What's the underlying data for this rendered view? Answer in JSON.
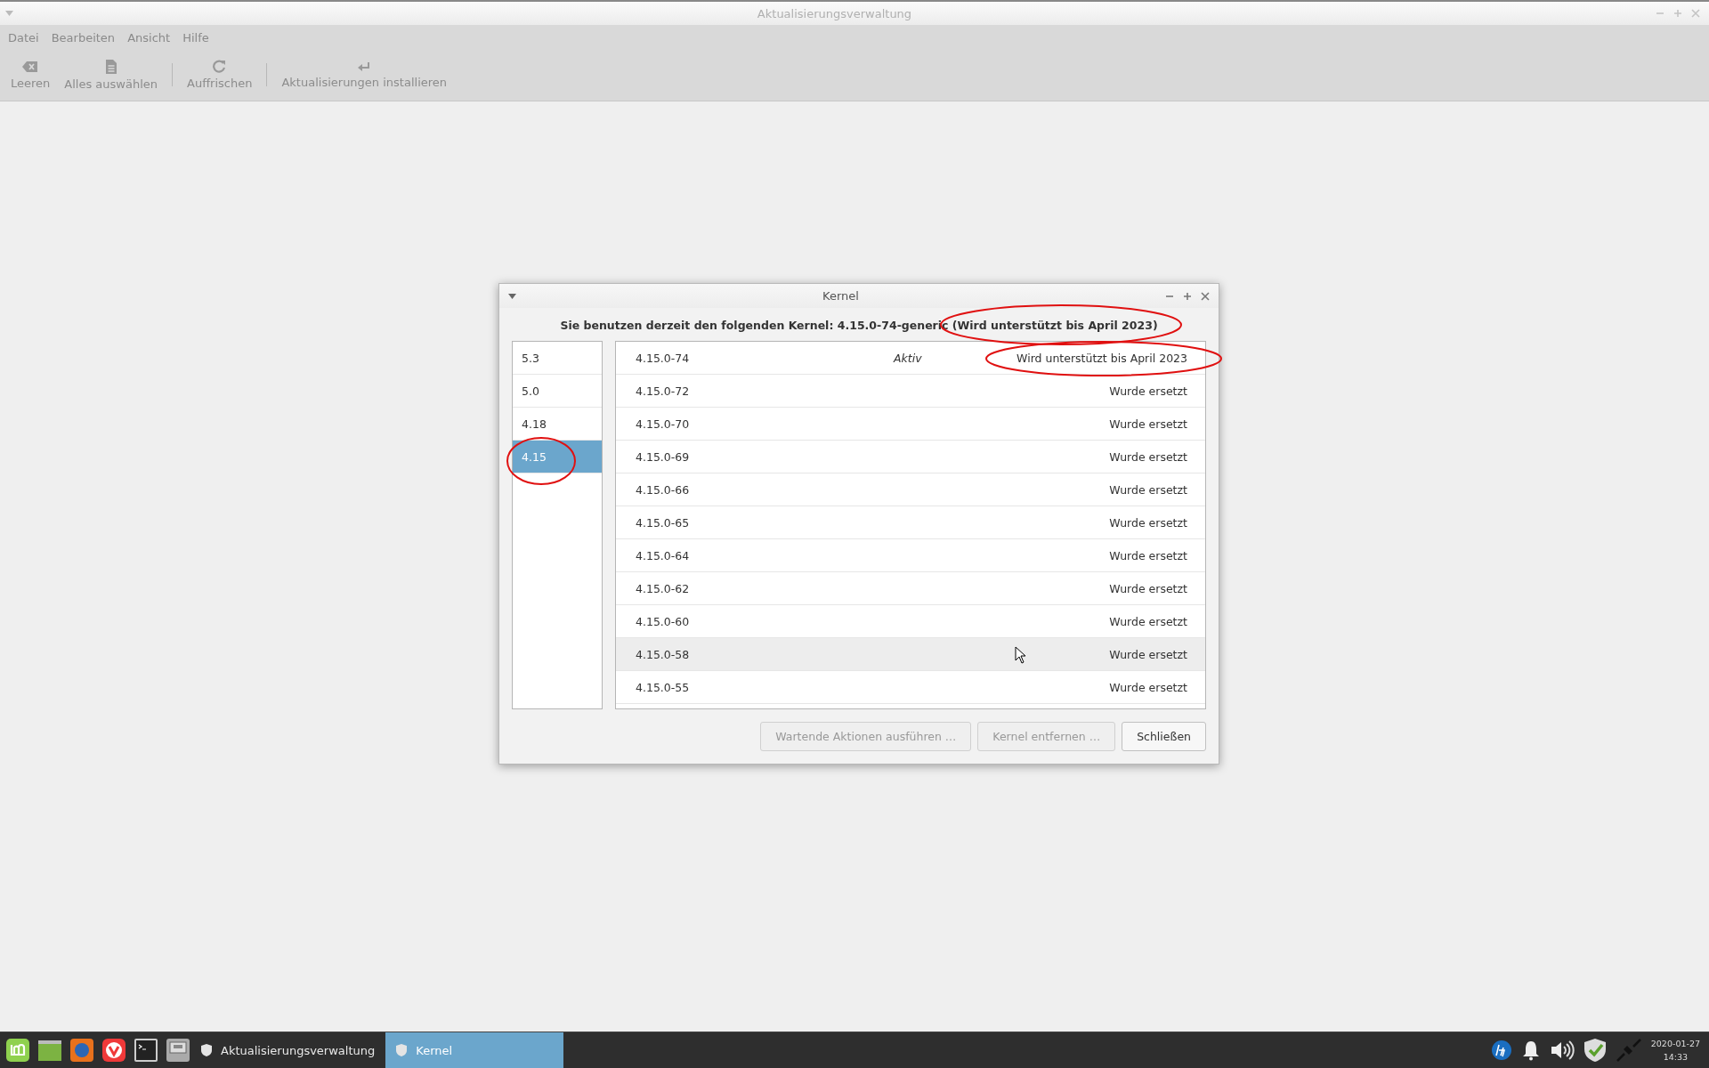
{
  "window": {
    "title": "Aktualisierungsverwaltung"
  },
  "menu": [
    "Datei",
    "Bearbeiten",
    "Ansicht",
    "Hilfe"
  ],
  "toolbar": [
    {
      "kind": "clear",
      "label": "Leeren"
    },
    {
      "kind": "selectall",
      "label": "Alles auswählen"
    },
    {
      "kind": "separator"
    },
    {
      "kind": "refresh",
      "label": "Auffrischen"
    },
    {
      "kind": "separator"
    },
    {
      "kind": "install",
      "label": "Aktualisierungen installieren"
    }
  ],
  "dialog": {
    "title": "Kernel",
    "headline": "Sie benutzen derzeit den folgenden Kernel: 4.15.0-74-generic (Wird unterstützt bis April 2023)",
    "series": [
      {
        "label": "5.3",
        "selected": false
      },
      {
        "label": "5.0",
        "selected": false
      },
      {
        "label": "4.18",
        "selected": false
      },
      {
        "label": "4.15",
        "selected": true
      }
    ],
    "kernels": [
      {
        "version": "4.15.0-74",
        "state": "Aktiv",
        "support": "Wird unterstützt bis April 2023",
        "hovered": false
      },
      {
        "version": "4.15.0-72",
        "support": "Wurde ersetzt",
        "hovered": false
      },
      {
        "version": "4.15.0-70",
        "support": "Wurde ersetzt",
        "hovered": false
      },
      {
        "version": "4.15.0-69",
        "support": "Wurde ersetzt",
        "hovered": false
      },
      {
        "version": "4.15.0-66",
        "support": "Wurde ersetzt",
        "hovered": false
      },
      {
        "version": "4.15.0-65",
        "support": "Wurde ersetzt",
        "hovered": false
      },
      {
        "version": "4.15.0-64",
        "support": "Wurde ersetzt",
        "hovered": false
      },
      {
        "version": "4.15.0-62",
        "support": "Wurde ersetzt",
        "hovered": false
      },
      {
        "version": "4.15.0-60",
        "support": "Wurde ersetzt",
        "hovered": false
      },
      {
        "version": "4.15.0-58",
        "support": "Wurde ersetzt",
        "hovered": true
      },
      {
        "version": "4.15.0-55",
        "support": "Wurde ersetzt",
        "hovered": false
      }
    ],
    "buttons": [
      {
        "label": "Wartende Aktionen ausführen …",
        "disabled": true
      },
      {
        "label": "Kernel entfernen …",
        "disabled": true
      },
      {
        "label": "Schließen",
        "disabled": false
      }
    ]
  },
  "taskbar": {
    "launchers": [
      {
        "kind": "mint"
      },
      {
        "kind": "files"
      },
      {
        "kind": "firefox"
      },
      {
        "kind": "vivaldi"
      },
      {
        "kind": "terminal"
      },
      {
        "kind": "disk"
      }
    ],
    "tasks": [
      {
        "label": "Aktualisierungsverwaltung",
        "selected": false
      },
      {
        "label": "Kernel",
        "selected": true
      }
    ],
    "date": "2020-01-27",
    "time": "14:33"
  }
}
